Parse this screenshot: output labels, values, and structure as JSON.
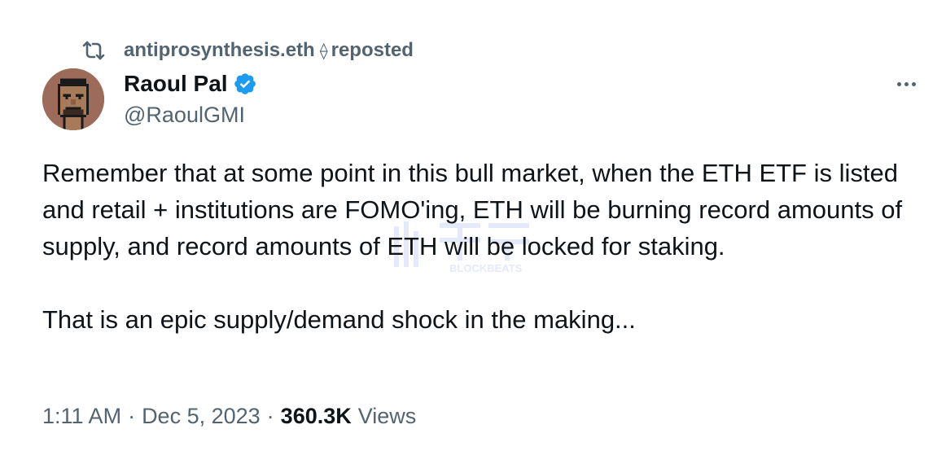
{
  "repost": {
    "user": "antiprosynthesis.eth",
    "eth_symbol": "⟠",
    "label": "reposted",
    "icon": "repost-icon"
  },
  "author": {
    "display_name": "Raoul Pal",
    "handle": "@RaoulGMI",
    "verified": true,
    "verified_color": "#1d9bf0",
    "avatar_bg": "#9d6b5a"
  },
  "more_icon": "more-horizontal-icon",
  "tweet": {
    "paragraphs": [
      "Remember that at some point in this bull market, when the ETH ETF is listed and retail + institutions are FOMO'ing, ETH will be burning record amounts of supply, and record amounts of ETH will be locked for staking.",
      "That is an epic supply/demand shock in the making..."
    ]
  },
  "meta": {
    "time": "1:11 AM",
    "date": "Dec 5, 2023",
    "separator": "·",
    "views_count": "360.3K",
    "views_label": "Views"
  },
  "watermark": {
    "text": "BLOCKBEATS"
  },
  "colors": {
    "text_primary": "#0f1419",
    "text_secondary": "#536471",
    "accent": "#1d9bf0"
  }
}
